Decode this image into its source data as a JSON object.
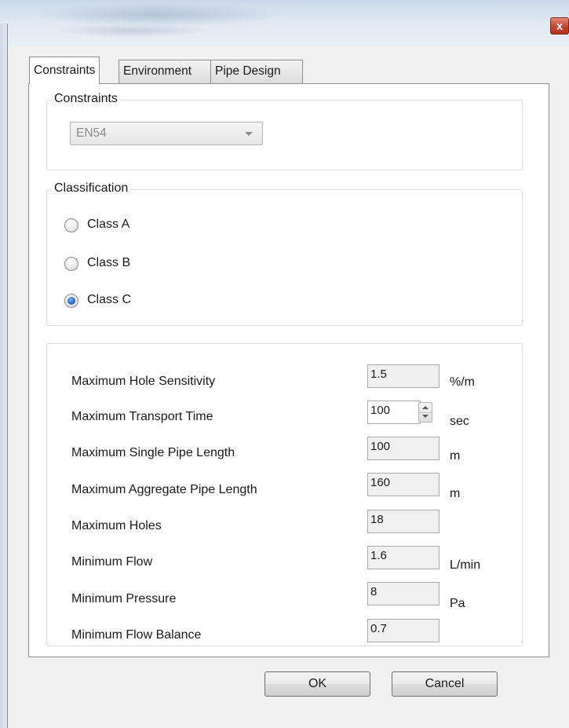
{
  "window": {
    "close_glyph": "x"
  },
  "tabs": [
    {
      "label": "Constraints",
      "active": true
    },
    {
      "label": "Environment",
      "active": false
    },
    {
      "label": "Pipe Design",
      "active": false
    }
  ],
  "constraints_group": {
    "title": "Constraints",
    "standard_value": "EN54"
  },
  "classification_group": {
    "title": "Classification",
    "options": [
      {
        "label": "Class A",
        "checked": false
      },
      {
        "label": "Class B",
        "checked": false
      },
      {
        "label": "Class C",
        "checked": true
      }
    ]
  },
  "parameters": [
    {
      "label": "Maximum Hole Sensitivity",
      "value": "1.5",
      "unit": "%/m"
    },
    {
      "label": "Maximum Transport Time",
      "value": "100",
      "unit": "sec"
    },
    {
      "label": "Maximum Single Pipe Length",
      "value": "100",
      "unit": "m"
    },
    {
      "label": "Maximum Aggregate Pipe Length",
      "value": "160",
      "unit": "m"
    },
    {
      "label": "Maximum Holes",
      "value": "18",
      "unit": ""
    },
    {
      "label": "Minimum Flow",
      "value": "1.6",
      "unit": "L/min"
    },
    {
      "label": "Minimum Pressure",
      "value": "8",
      "unit": "Pa"
    },
    {
      "label": "Minimum Flow Balance",
      "value": "0.7",
      "unit": ""
    }
  ],
  "buttons": {
    "ok": "OK",
    "cancel": "Cancel"
  },
  "colors": {
    "selected_radio": "#2a6fc9",
    "close_button": "#c7432b"
  }
}
